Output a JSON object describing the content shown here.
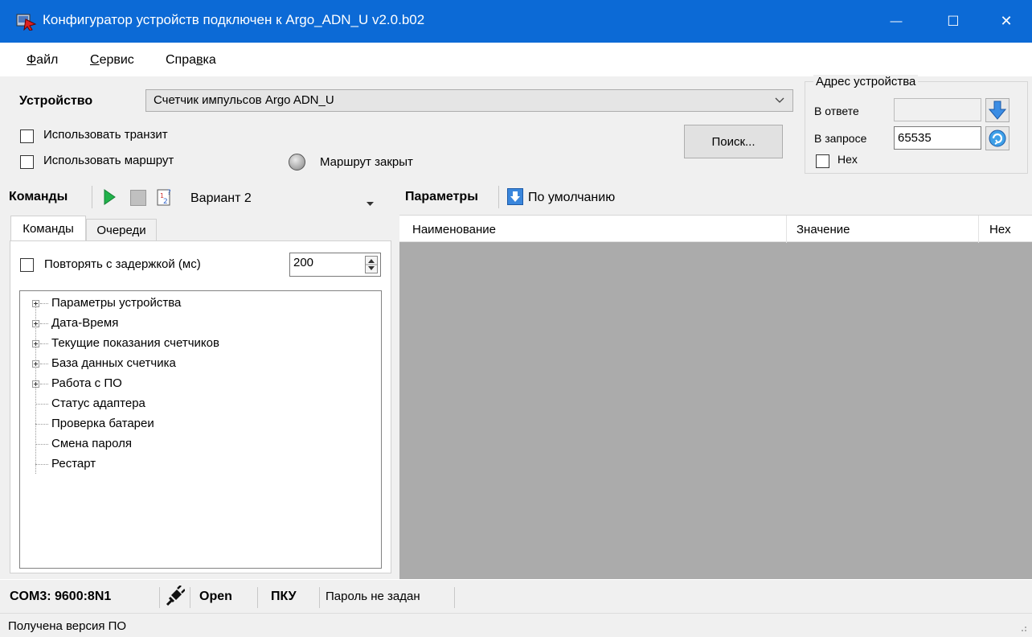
{
  "window": {
    "title": "Конфигуратор устройств подключен к Argo_ADN_U v2.0.b02",
    "minimize_glyph": "—",
    "maximize_glyph": "☐",
    "close_glyph": "✕",
    "titlebar_color": "#0c6ad6"
  },
  "menu": {
    "file_accel": "Ф",
    "file_rest": "айл",
    "service_accel": "С",
    "service_rest": "ервис",
    "help_pre": "Спра",
    "help_accel": "в",
    "help_rest": "ка"
  },
  "device": {
    "label": "Устройство",
    "selected": "Счетчик импульсов Argo ADN_U"
  },
  "options": {
    "use_transit": "Использовать транзит",
    "use_route": "Использовать маршрут",
    "route_status": "Маршрут закрыт",
    "search_button": "Поиск..."
  },
  "address": {
    "title": "Адрес устройства",
    "response_label": "В ответе",
    "response_value": "",
    "request_label": "В запросе",
    "request_value": "65535",
    "hex_label": "Hex"
  },
  "commands_toolbar": {
    "label": "Команды",
    "variant": "Вариант 2",
    "icons": [
      "play-icon",
      "stop-icon",
      "variant-icon"
    ]
  },
  "params_toolbar": {
    "label": "Параметры",
    "default_label": "По умолчанию"
  },
  "tabs": {
    "commands": "Команды",
    "queues": "Очереди"
  },
  "repeat": {
    "label": "Повторять с задержкой (мс)",
    "value": "200"
  },
  "tree": {
    "items": [
      {
        "label": "Параметры устройства",
        "expandable": true
      },
      {
        "label": "Дата-Время",
        "expandable": true
      },
      {
        "label": "Текущие показания счетчиков",
        "expandable": true
      },
      {
        "label": "База данных счетчика",
        "expandable": true
      },
      {
        "label": "Работа с ПО",
        "expandable": true
      },
      {
        "label": "Статус адаптера",
        "expandable": false
      },
      {
        "label": "Проверка батареи",
        "expandable": false
      },
      {
        "label": "Смена пароля",
        "expandable": false
      },
      {
        "label": "Рестарт",
        "expandable": false
      }
    ]
  },
  "params_table": {
    "columns": [
      "Наименование",
      "Значение",
      "Hex"
    ]
  },
  "status": {
    "port": "COM3: 9600:8N1",
    "state": "Open",
    "mode": "ПКУ",
    "password": "Пароль не задан",
    "message": "Получена версия ПО"
  }
}
